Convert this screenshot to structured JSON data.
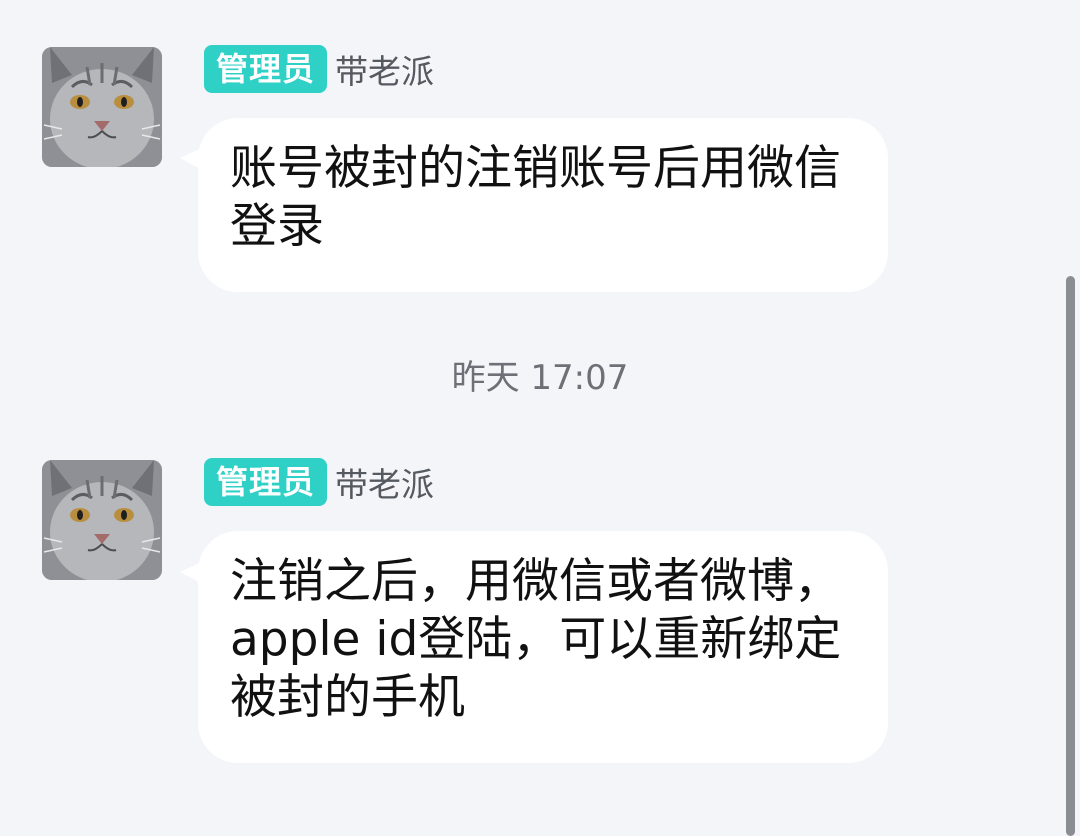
{
  "messages": [
    {
      "badge": "管理员",
      "sender": "带老派",
      "text": "账号被封的注销账号后用微信登录"
    },
    {
      "badge": "管理员",
      "sender": "带老派",
      "text": "注销之后，用微信或者微博，apple id登陆，可以重新绑定被封的手机"
    }
  ],
  "timestamp": "昨天 17:07",
  "icons": {
    "avatar": "cat-avatar-icon"
  },
  "colors": {
    "background": "#f4f5f9",
    "badge": "#2fd0c6",
    "bubble": "#ffffff"
  }
}
